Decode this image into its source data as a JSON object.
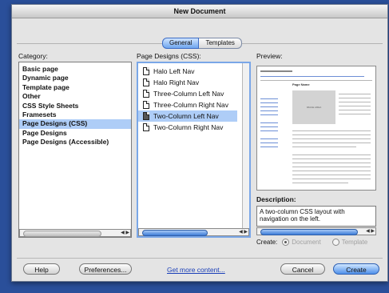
{
  "window": {
    "title": "New Document"
  },
  "tabs": [
    {
      "label": "General",
      "active": true
    },
    {
      "label": "Templates",
      "active": false
    }
  ],
  "category": {
    "label": "Category:",
    "items": [
      {
        "label": "Basic page"
      },
      {
        "label": "Dynamic page"
      },
      {
        "label": "Template page"
      },
      {
        "label": "Other"
      },
      {
        "label": "CSS Style Sheets"
      },
      {
        "label": "Framesets"
      },
      {
        "label": "Page Designs (CSS)",
        "selected": true
      },
      {
        "label": "Page Designs"
      },
      {
        "label": "Page Designs (Accessible)"
      }
    ]
  },
  "page_designs": {
    "label": "Page Designs (CSS):",
    "items": [
      {
        "label": "Halo Left Nav"
      },
      {
        "label": "Halo Right Nav"
      },
      {
        "label": "Three-Column Left Nav"
      },
      {
        "label": "Three-Column Right Nav"
      },
      {
        "label": "Two-Column Left Nav",
        "selected": true
      },
      {
        "label": "Two-Column Right Nav"
      }
    ]
  },
  "preview": {
    "label": "Preview:",
    "page_title": "Page Name",
    "image_label": "IMAGE AREA"
  },
  "description": {
    "label": "Description:",
    "text": "A two-column CSS layout with navigation on the left."
  },
  "create": {
    "label": "Create:",
    "options": [
      {
        "label": "Document",
        "selected": true
      },
      {
        "label": "Template",
        "selected": false
      }
    ]
  },
  "buttons": {
    "help": "Help",
    "preferences": "Preferences...",
    "get_more": "Get more content...",
    "cancel": "Cancel",
    "create": "Create"
  },
  "colors": {
    "accent": "#4f90ea",
    "selection": "#aecdf7",
    "desktop": "#2a4f9a"
  }
}
